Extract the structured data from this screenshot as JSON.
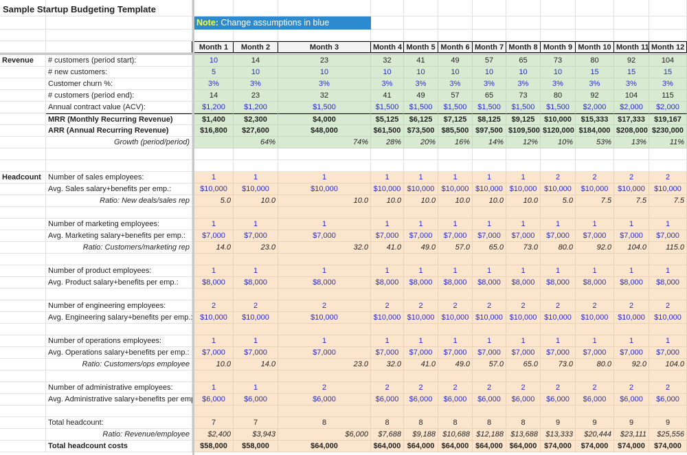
{
  "title": "Sample Startup Budgeting Template",
  "note": {
    "prefix": "Note:",
    "text": " Change assumptions in blue",
    "bg_color": "#2b8ad0",
    "prefix_color": "#ffff33"
  },
  "colors": {
    "revenue_bg": "#d9ead3",
    "headcount_bg": "#fce5cd",
    "input_text": "#2a2acc"
  },
  "months": [
    "Month 1",
    "Month 2",
    "Month 3",
    "Month 4",
    "Month 5",
    "Month 6",
    "Month 7",
    "Month 8",
    "Month 9",
    "Month 10",
    "Month 11",
    "Month 12"
  ],
  "revenue": {
    "section": "Revenue",
    "rows": [
      {
        "label": "# customers (period start):",
        "style": "mixed-start",
        "values": [
          "10",
          "14",
          "23",
          "32",
          "41",
          "49",
          "57",
          "65",
          "73",
          "80",
          "92",
          "104"
        ]
      },
      {
        "label": "# new customers:",
        "style": "input",
        "values": [
          "5",
          "10",
          "10",
          "10",
          "10",
          "10",
          "10",
          "10",
          "10",
          "15",
          "15",
          "15"
        ]
      },
      {
        "label": "Customer churn %:",
        "style": "input",
        "values": [
          "3%",
          "3%",
          "3%",
          "3%",
          "3%",
          "3%",
          "3%",
          "3%",
          "3%",
          "3%",
          "3%",
          "3%"
        ]
      },
      {
        "label": "# customers (period end):",
        "style": "calc",
        "values": [
          "14",
          "23",
          "32",
          "41",
          "49",
          "57",
          "65",
          "73",
          "80",
          "92",
          "104",
          "115"
        ]
      },
      {
        "label": "Annual contract value (ACV):",
        "style": "input",
        "values": [
          "$1,200",
          "$1,200",
          "$1,500",
          "$1,500",
          "$1,500",
          "$1,500",
          "$1,500",
          "$1,500",
          "$1,500",
          "$2,000",
          "$2,000",
          "$2,000"
        ]
      },
      {
        "label": "MRR (Monthly Recurring Revenue)",
        "style": "bold-top",
        "values": [
          "$1,400",
          "$2,300",
          "$4,000",
          "$5,125",
          "$6,125",
          "$7,125",
          "$8,125",
          "$9,125",
          "$10,000",
          "$15,333",
          "$17,333",
          "$19,167"
        ]
      },
      {
        "label": "ARR (Annual Recurring Revenue)",
        "style": "bold",
        "values": [
          "$16,800",
          "$27,600",
          "$48,000",
          "$61,500",
          "$73,500",
          "$85,500",
          "$97,500",
          "$109,500",
          "$120,000",
          "$184,000",
          "$208,000",
          "$230,000"
        ]
      },
      {
        "label": "Growth (period/period)",
        "style": "ratio",
        "values": [
          "",
          "64%",
          "74%",
          "28%",
          "20%",
          "16%",
          "14%",
          "12%",
          "10%",
          "53%",
          "13%",
          "11%"
        ]
      }
    ]
  },
  "headcount": {
    "section": "Headcount",
    "rows": [
      {
        "label": "Number of sales employees:",
        "style": "input",
        "values": [
          "1",
          "1",
          "1",
          "1",
          "1",
          "1",
          "1",
          "1",
          "2",
          "2",
          "2",
          "2"
        ]
      },
      {
        "label": "Avg. Sales salary+benefits per emp.:",
        "style": "input",
        "values": [
          "$10,000",
          "$10,000",
          "$10,000",
          "$10,000",
          "$10,000",
          "$10,000",
          "$10,000",
          "$10,000",
          "$10,000",
          "$10,000",
          "$10,000",
          "$10,000"
        ]
      },
      {
        "label": "Ratio: New deals/sales rep",
        "style": "ratio",
        "values": [
          "5.0",
          "10.0",
          "10.0",
          "10.0",
          "10.0",
          "10.0",
          "10.0",
          "10.0",
          "5.0",
          "7.5",
          "7.5",
          "7.5"
        ]
      },
      {
        "label": "",
        "style": "blank",
        "values": []
      },
      {
        "label": "Number of marketing employees:",
        "style": "input",
        "values": [
          "1",
          "1",
          "1",
          "1",
          "1",
          "1",
          "1",
          "1",
          "1",
          "1",
          "1",
          "1"
        ]
      },
      {
        "label": "Avg. Marketing salary+benefits per emp.:",
        "style": "input",
        "values": [
          "$7,000",
          "$7,000",
          "$7,000",
          "$7,000",
          "$7,000",
          "$7,000",
          "$7,000",
          "$7,000",
          "$7,000",
          "$7,000",
          "$7,000",
          "$7,000"
        ]
      },
      {
        "label": "Ratio: Customers/marketing rep",
        "style": "ratio",
        "values": [
          "14.0",
          "23.0",
          "32.0",
          "41.0",
          "49.0",
          "57.0",
          "65.0",
          "73.0",
          "80.0",
          "92.0",
          "104.0",
          "115.0"
        ]
      },
      {
        "label": "",
        "style": "blank",
        "values": []
      },
      {
        "label": "Number of product employees:",
        "style": "input",
        "values": [
          "1",
          "1",
          "1",
          "1",
          "1",
          "1",
          "1",
          "1",
          "1",
          "1",
          "1",
          "1"
        ]
      },
      {
        "label": "Avg. Product salary+benefits per emp.:",
        "style": "input",
        "values": [
          "$8,000",
          "$8,000",
          "$8,000",
          "$8,000",
          "$8,000",
          "$8,000",
          "$8,000",
          "$8,000",
          "$8,000",
          "$8,000",
          "$8,000",
          "$8,000"
        ]
      },
      {
        "label": "",
        "style": "blank",
        "values": []
      },
      {
        "label": "Number of engineering employees:",
        "style": "input",
        "values": [
          "2",
          "2",
          "2",
          "2",
          "2",
          "2",
          "2",
          "2",
          "2",
          "2",
          "2",
          "2"
        ]
      },
      {
        "label": "Avg. Engineering salary+benefits per emp.:",
        "style": "input",
        "values": [
          "$10,000",
          "$10,000",
          "$10,000",
          "$10,000",
          "$10,000",
          "$10,000",
          "$10,000",
          "$10,000",
          "$10,000",
          "$10,000",
          "$10,000",
          "$10,000"
        ]
      },
      {
        "label": "",
        "style": "blank",
        "values": []
      },
      {
        "label": "Number of operations employees:",
        "style": "input",
        "values": [
          "1",
          "1",
          "1",
          "1",
          "1",
          "1",
          "1",
          "1",
          "1",
          "1",
          "1",
          "1"
        ]
      },
      {
        "label": "Avg. Operations salary+benefits per emp.:",
        "style": "input",
        "values": [
          "$7,000",
          "$7,000",
          "$7,000",
          "$7,000",
          "$7,000",
          "$7,000",
          "$7,000",
          "$7,000",
          "$7,000",
          "$7,000",
          "$7,000",
          "$7,000"
        ]
      },
      {
        "label": "Ratio: Customers/ops employee",
        "style": "ratio",
        "values": [
          "10.0",
          "14.0",
          "23.0",
          "32.0",
          "41.0",
          "49.0",
          "57.0",
          "65.0",
          "73.0",
          "80.0",
          "92.0",
          "104.0"
        ]
      },
      {
        "label": "",
        "style": "blank",
        "values": []
      },
      {
        "label": "Number of administrative employees:",
        "style": "input",
        "values": [
          "1",
          "1",
          "2",
          "2",
          "2",
          "2",
          "2",
          "2",
          "2",
          "2",
          "2",
          "2"
        ]
      },
      {
        "label": "Avg. Administrative salary+benefits per emp.",
        "style": "input",
        "values": [
          "$6,000",
          "$6,000",
          "$6,000",
          "$6,000",
          "$6,000",
          "$6,000",
          "$6,000",
          "$6,000",
          "$6,000",
          "$6,000",
          "$6,000",
          "$6,000"
        ]
      },
      {
        "label": "",
        "style": "blank",
        "values": []
      },
      {
        "label": "Total headcount:",
        "style": "calc",
        "values": [
          "7",
          "7",
          "8",
          "8",
          "8",
          "8",
          "8",
          "8",
          "9",
          "9",
          "9",
          "9"
        ]
      },
      {
        "label": "Ratio: Revenue/employee",
        "style": "ratio",
        "values": [
          "$2,400",
          "$3,943",
          "$6,000",
          "$7,688",
          "$9,188",
          "$10,688",
          "$12,188",
          "$13,688",
          "$13,333",
          "$20,444",
          "$23,111",
          "$25,556"
        ]
      },
      {
        "label": "Total headcount costs",
        "style": "bold",
        "values": [
          "$58,000",
          "$58,000",
          "$64,000",
          "$64,000",
          "$64,000",
          "$64,000",
          "$64,000",
          "$64,000",
          "$74,000",
          "$74,000",
          "$74,000",
          "$74,000"
        ]
      }
    ]
  }
}
